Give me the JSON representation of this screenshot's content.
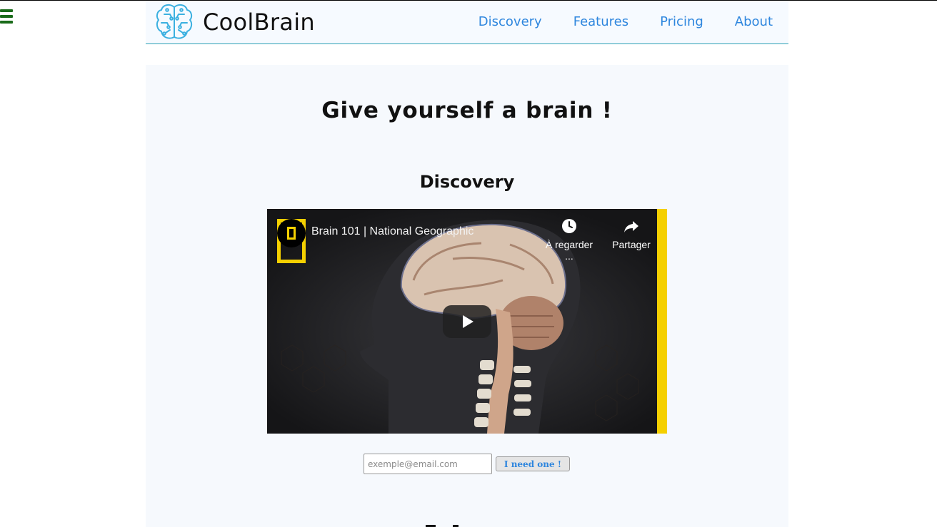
{
  "menu": {
    "icon": "hamburger-menu-icon"
  },
  "header": {
    "logo_icon": "brain-circuit-icon",
    "brand": "CoolBrain",
    "nav": [
      {
        "label": "Discovery"
      },
      {
        "label": "Features"
      },
      {
        "label": "Pricing"
      },
      {
        "label": "About"
      }
    ]
  },
  "main": {
    "headline": "Give yourself a brain !",
    "section_title": "Discovery",
    "video": {
      "title": "Brain 101 | National Geographic",
      "watch_later_label": "À regarder ...",
      "share_label": "Partager",
      "play_icon": "play-icon",
      "channel_logo": "national-geographic-logo"
    },
    "signup": {
      "email_placeholder": "exemple@email.com",
      "email_value": "",
      "button_label": "I need one !"
    }
  },
  "colors": {
    "link": "#2e86de",
    "header_border": "#2aa0b5",
    "menu_icon": "#1a6b1a",
    "natgeo_yellow": "#f5d000"
  }
}
